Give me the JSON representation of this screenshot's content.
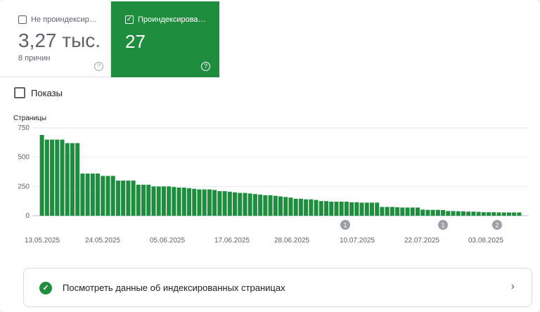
{
  "tiles": {
    "unindexed": {
      "label": "Не проиндексир…",
      "value": "3,27 тыс.",
      "sub": "8 причин",
      "help": "?"
    },
    "indexed": {
      "label": "Проиндексирова…",
      "value": "27",
      "help": "?",
      "check": "✓"
    }
  },
  "impressions": {
    "label": "Показы"
  },
  "link": {
    "label": "Посмотреть данные об индексированных страницах",
    "icon": "check-circle-icon",
    "chevron": "›",
    "check": "✓"
  },
  "colors": {
    "accent": "#1e8e3e",
    "bar": "#1e8e3e",
    "grid": "#e8eaed"
  },
  "chart_data": {
    "type": "bar",
    "ylabel": "Страницы",
    "ylim": [
      0,
      750
    ],
    "yticks": [
      "750",
      "500",
      "250",
      "0"
    ],
    "ytick_values": [
      750,
      500,
      250,
      0
    ],
    "xtick_labels": [
      "13.05.2025",
      "24.05.2025",
      "05.06.2025",
      "17.06.2025",
      "28.06.2025",
      "10.07.2025",
      "22.07.2025",
      "03.08.2025"
    ],
    "annotations": [
      {
        "label": "1",
        "near": "10.07.2025"
      },
      {
        "label": "1",
        "near": "22.07.2025"
      },
      {
        "label": "2",
        "near": "03.08.2025"
      }
    ],
    "values": [
      690,
      650,
      650,
      650,
      650,
      620,
      620,
      620,
      360,
      360,
      360,
      360,
      340,
      340,
      340,
      300,
      300,
      300,
      300,
      265,
      265,
      265,
      250,
      250,
      250,
      250,
      245,
      240,
      240,
      235,
      230,
      225,
      225,
      225,
      220,
      210,
      210,
      205,
      200,
      195,
      195,
      190,
      185,
      180,
      175,
      175,
      170,
      165,
      160,
      155,
      145,
      145,
      140,
      140,
      135,
      125,
      125,
      120,
      120,
      120,
      120,
      115,
      115,
      112,
      112,
      112,
      112,
      75,
      75,
      75,
      72,
      70,
      70,
      70,
      70,
      52,
      50,
      50,
      50,
      48,
      40,
      40,
      38,
      38,
      35,
      35,
      33,
      30,
      30,
      30,
      28,
      28,
      28,
      28,
      28
    ]
  }
}
